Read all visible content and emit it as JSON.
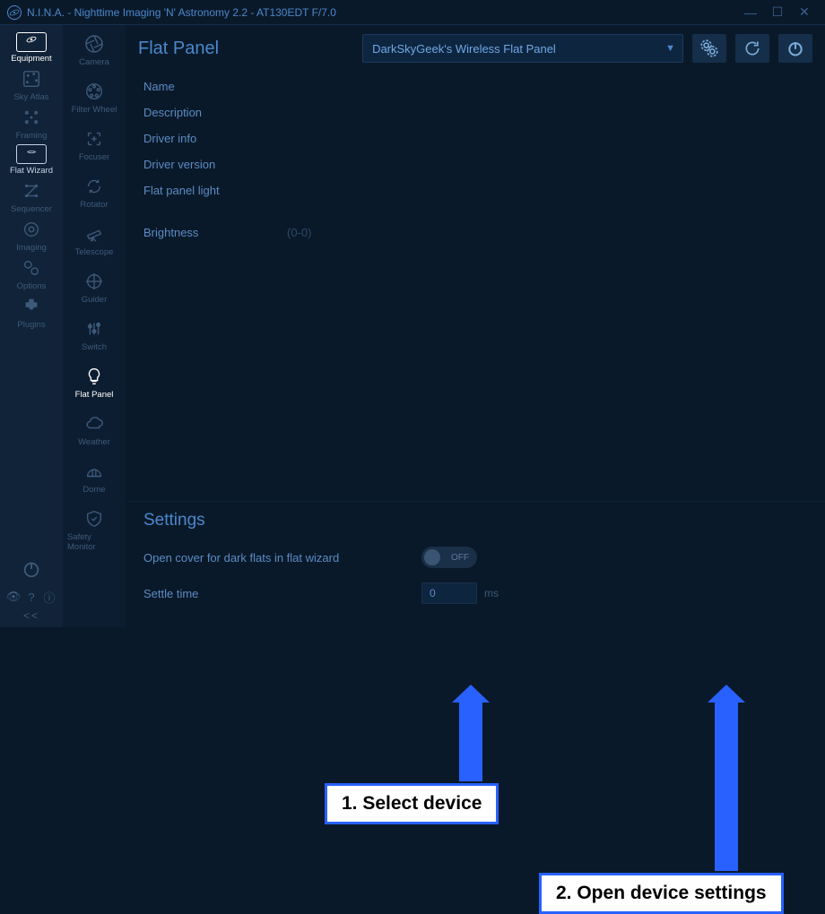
{
  "titlebar": {
    "title": "N.I.N.A. - Nighttime Imaging 'N' Astronomy 2.2   -   AT130EDT F/7.0"
  },
  "nav1": [
    {
      "label": "Equipment",
      "icon": "equipment",
      "active": true,
      "boxed": true
    },
    {
      "label": "Sky Atlas",
      "icon": "atlas"
    },
    {
      "label": "Framing",
      "icon": "framing"
    },
    {
      "label": "Flat Wizard",
      "icon": "flatwizard",
      "semi": true,
      "boxed": true
    },
    {
      "label": "Sequencer",
      "icon": "sequencer"
    },
    {
      "label": "Imaging",
      "icon": "imaging"
    },
    {
      "label": "Options",
      "icon": "gears"
    },
    {
      "label": "Plugins",
      "icon": "plugin"
    }
  ],
  "nav2": [
    {
      "label": "Camera",
      "icon": "aperture"
    },
    {
      "label": "Filter Wheel",
      "icon": "wheel"
    },
    {
      "label": "Focuser",
      "icon": "focuser"
    },
    {
      "label": "Rotator",
      "icon": "rotator"
    },
    {
      "label": "Telescope",
      "icon": "telescope"
    },
    {
      "label": "Guider",
      "icon": "guider"
    },
    {
      "label": "Switch",
      "icon": "switch"
    },
    {
      "label": "Flat Panel",
      "icon": "bulb",
      "active": true
    },
    {
      "label": "Weather",
      "icon": "cloud"
    },
    {
      "label": "Dome",
      "icon": "dome"
    },
    {
      "label": "Safety Monitor",
      "icon": "shield"
    }
  ],
  "page": {
    "title": "Flat Panel",
    "device_selected": "DarkSkyGeek's Wireless Flat Panel"
  },
  "fields": [
    {
      "label": "Name"
    },
    {
      "label": "Description"
    },
    {
      "label": "Driver info"
    },
    {
      "label": "Driver version"
    },
    {
      "label": "Flat panel light"
    }
  ],
  "brightness": {
    "label": "Brightness",
    "hint": "(0-0)"
  },
  "settings": {
    "title": "Settings",
    "open_cover_label": "Open cover for dark flats in flat wizard",
    "open_cover_state": "OFF",
    "settle_label": "Settle time",
    "settle_value": "0",
    "settle_unit": "ms"
  },
  "callouts": {
    "c1": "1. Select device",
    "c2": "2. Open device settings"
  }
}
